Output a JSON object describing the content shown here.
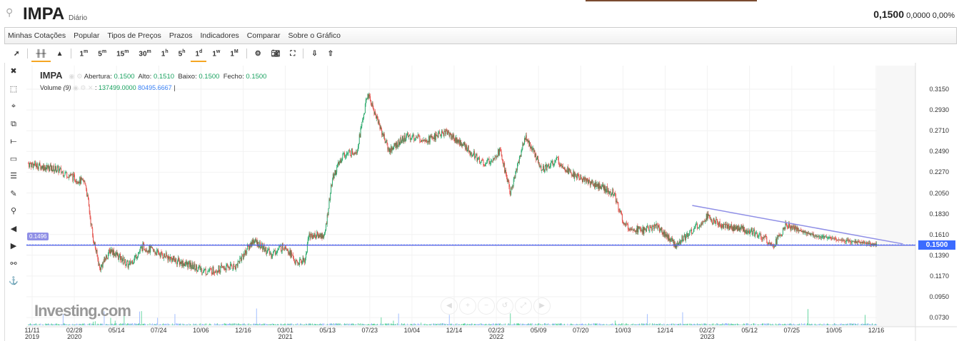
{
  "header": {
    "symbol": "IMPA",
    "period": "Diário",
    "price": "0,1500",
    "change": "0,0000",
    "change_pct": "0,00%"
  },
  "menu": [
    "Minhas Cotações",
    "Popular",
    "Tipos de Preços",
    "Prazos",
    "Indicadores",
    "Comparar",
    "Sobre o Gráfico"
  ],
  "toolbar": {
    "intervals": [
      {
        "n": "1",
        "u": "m"
      },
      {
        "n": "5",
        "u": "m"
      },
      {
        "n": "15",
        "u": "m"
      },
      {
        "n": "30",
        "u": "m"
      },
      {
        "n": "1",
        "u": "h"
      },
      {
        "n": "5",
        "u": "h"
      },
      {
        "n": "1",
        "u": "d"
      },
      {
        "n": "1",
        "u": "w"
      },
      {
        "n": "1",
        "u": "M"
      }
    ],
    "active": "1d"
  },
  "legend": {
    "symbol": "IMPA",
    "open_label": "Abertura:",
    "open": "0.1500",
    "high_label": "Alto:",
    "high": "0.1510",
    "low_label": "Baixo:",
    "low": "0.1500",
    "close_label": "Fecho:",
    "close": "0.1500",
    "volume_label": "Volume",
    "volume_period": "(9)",
    "volume": "137499.0000",
    "volume_ma": "80495.6667"
  },
  "logo": "Investing.com",
  "colors": {
    "up": "#1aa260",
    "down": "#e0403a",
    "line": "#8f8fe6",
    "accent": "#3b6bff"
  },
  "chart_data": {
    "type": "candlestick",
    "price_ticks": [
      "0.3150",
      "0.2930",
      "0.2710",
      "0.2490",
      "0.2270",
      "0.2050",
      "0.1830",
      "0.1610",
      "0.1390",
      "0.1170",
      "0.0950",
      "0.0730"
    ],
    "ylim": [
      0.0625,
      0.3236
    ],
    "date_ticks": [
      {
        "l": "11/11",
        "y": "2019"
      },
      {
        "l": "02/28",
        "y": "2020"
      },
      {
        "l": "05/14"
      },
      {
        "l": "07/24"
      },
      {
        "l": "10/06"
      },
      {
        "l": "12/16"
      },
      {
        "l": "03/01",
        "y": "2021"
      },
      {
        "l": "05/13"
      },
      {
        "l": "07/23"
      },
      {
        "l": "10/04"
      },
      {
        "l": "12/14"
      },
      {
        "l": "02/23",
        "y": "2022"
      },
      {
        "l": "05/09"
      },
      {
        "l": "07/20"
      },
      {
        "l": "10/03"
      },
      {
        "l": "12/14"
      },
      {
        "l": "02/27",
        "y": "2023"
      },
      {
        "l": "05/12"
      },
      {
        "l": "07/25"
      },
      {
        "l": "10/05"
      },
      {
        "l": "12/16"
      }
    ],
    "close_path_trading_day": [
      [
        3,
        0.236
      ],
      [
        48,
        0.23
      ],
      [
        92,
        0.215
      ],
      [
        103,
        0.16
      ],
      [
        114,
        0.125
      ],
      [
        131,
        0.145
      ],
      [
        159,
        0.128
      ],
      [
        181,
        0.148
      ],
      [
        226,
        0.135
      ],
      [
        281,
        0.122
      ],
      [
        326,
        0.128
      ],
      [
        353,
        0.155
      ],
      [
        381,
        0.14
      ],
      [
        403,
        0.15
      ],
      [
        420,
        0.13
      ],
      [
        434,
        0.135
      ],
      [
        439,
        0.16
      ],
      [
        464,
        0.16
      ],
      [
        476,
        0.22
      ],
      [
        492,
        0.245
      ],
      [
        514,
        0.25
      ],
      [
        531,
        0.31
      ],
      [
        542,
        0.29
      ],
      [
        564,
        0.25
      ],
      [
        592,
        0.265
      ],
      [
        626,
        0.262
      ],
      [
        653,
        0.27
      ],
      [
        681,
        0.255
      ],
      [
        714,
        0.235
      ],
      [
        737,
        0.25
      ],
      [
        753,
        0.205
      ],
      [
        776,
        0.265
      ],
      [
        803,
        0.23
      ],
      [
        826,
        0.24
      ],
      [
        848,
        0.225
      ],
      [
        881,
        0.215
      ],
      [
        914,
        0.205
      ],
      [
        931,
        0.17
      ],
      [
        959,
        0.165
      ],
      [
        981,
        0.17
      ],
      [
        1009,
        0.15
      ],
      [
        1037,
        0.165
      ],
      [
        1059,
        0.18
      ],
      [
        1081,
        0.17
      ],
      [
        1126,
        0.165
      ],
      [
        1164,
        0.15
      ],
      [
        1181,
        0.17
      ],
      [
        1226,
        0.16
      ],
      [
        1270,
        0.155
      ],
      [
        1323,
        0.15
      ]
    ],
    "horizontal_line": {
      "value": "0.1496"
    },
    "trendline": {
      "start": [
        1036,
        0.1918
      ],
      "end": [
        1364,
        0.151
      ]
    },
    "last_price": "0.1500"
  }
}
